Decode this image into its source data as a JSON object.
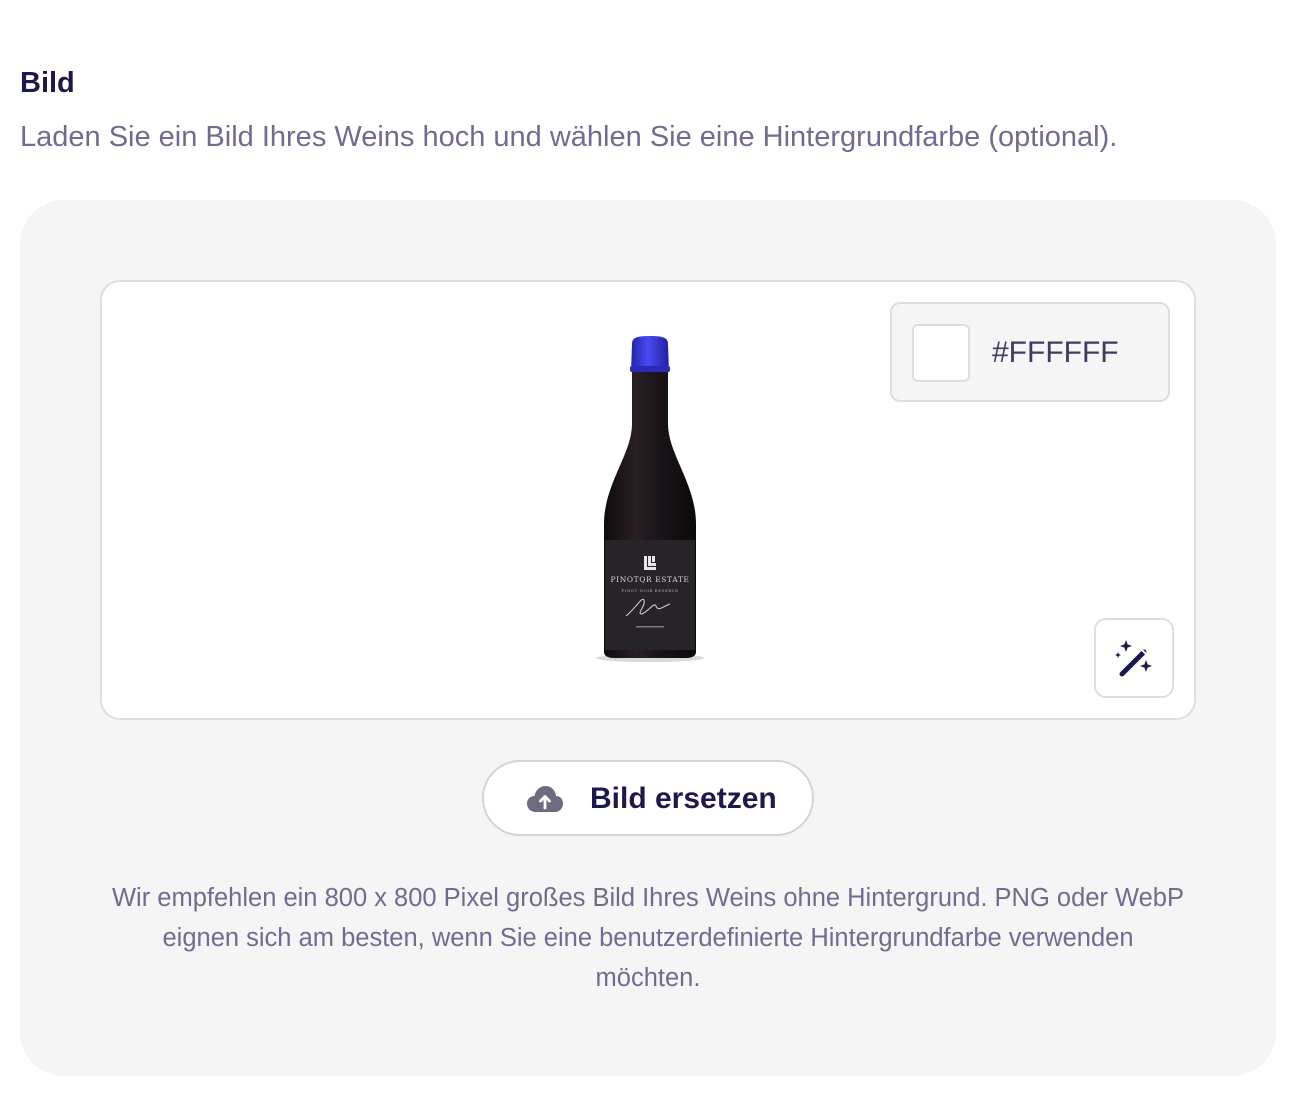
{
  "section": {
    "title": "Bild",
    "subtitle": "Laden Sie ein Bild Ihres Weins hoch und wählen Sie eine Hintergrundfarbe (optional)."
  },
  "preview": {
    "background_color": "#FFFFFF",
    "color_hex_label": "#FFFFFF",
    "magic_icon": "magic-wand-sparkles-icon",
    "bottle": {
      "capsule_color": "#3a3ad6",
      "glass_color": "#1a1418",
      "label_color": "#262428",
      "brand": "PINOTQR ESTATE",
      "sub_label": "PINOT NOIR RESERVE"
    }
  },
  "replace_button": {
    "icon": "cloud-upload-icon",
    "label": "Bild ersetzen"
  },
  "hint_text": "Wir empfehlen ein 800 x 800 Pixel großes Bild Ihres Weins ohne Hintergrund. PNG oder WebP eignen sich am besten, wenn Sie eine benutzerdefinierte Hintergrundfarbe verwenden möchten.",
  "colors": {
    "heading": "#1c1a4a",
    "muted_text": "#726b8f",
    "card_background": "#f5f5f6",
    "border": "#dedde3"
  }
}
